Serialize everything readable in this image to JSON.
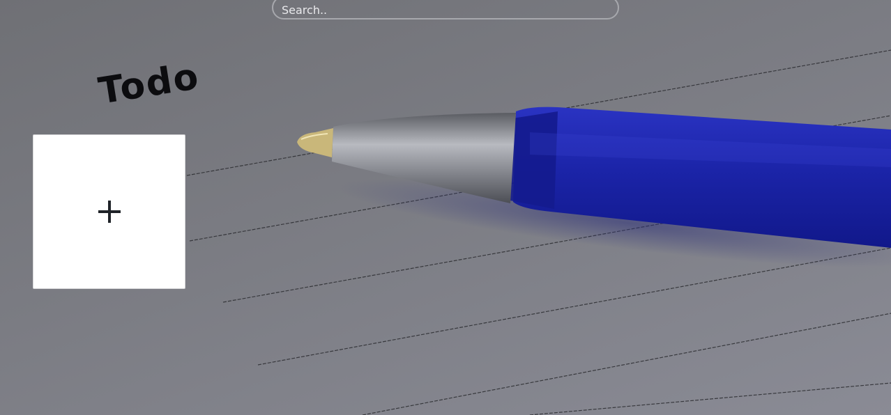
{
  "search": {
    "placeholder": "Search..",
    "value": ""
  },
  "background": {
    "note_text": "Todo"
  },
  "add_card": {
    "icon": "plus-icon"
  },
  "colors": {
    "overlay": "#767780",
    "card": "#ffffff",
    "pen_blue": "#1e2ab0",
    "search_border": "#a7a8ad"
  }
}
